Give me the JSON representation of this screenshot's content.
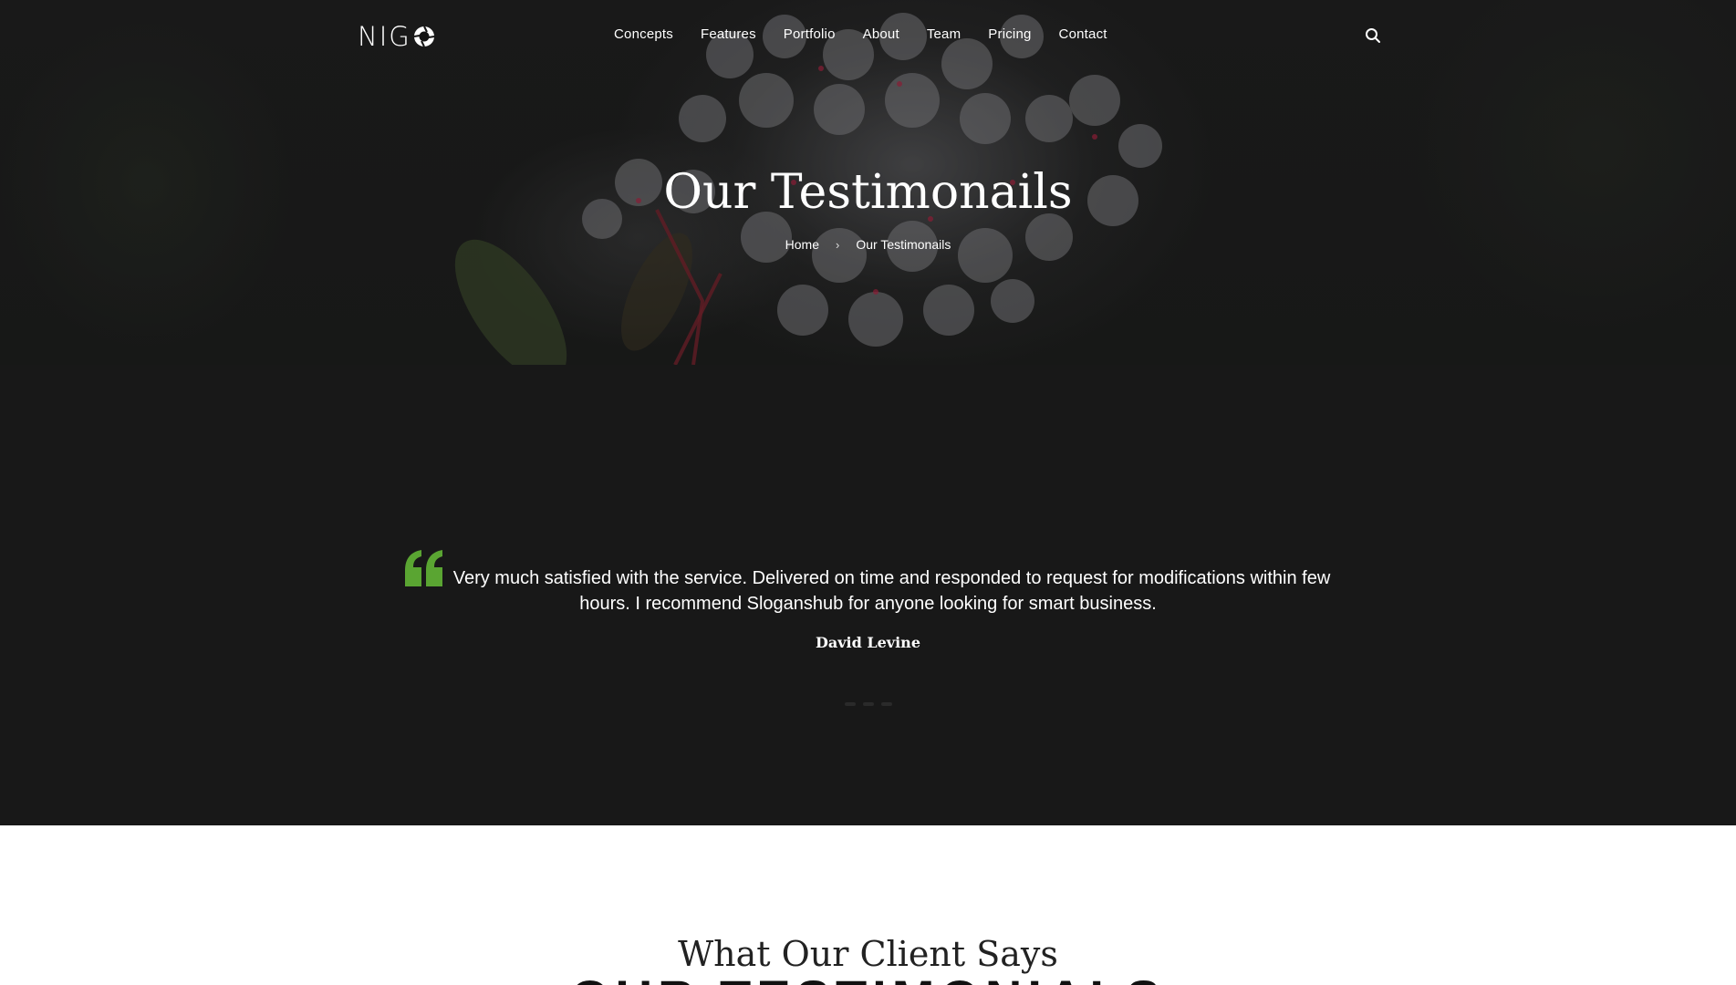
{
  "brand": {
    "name": "NIG",
    "logo_icon": "aperture-icon"
  },
  "nav": {
    "items": [
      "Concepts",
      "Features",
      "Portfolio",
      "About",
      "Team",
      "Pricing",
      "Contact"
    ],
    "search_icon": "search-icon"
  },
  "hero": {
    "title": "Our Testimonails",
    "breadcrumb": {
      "home": "Home",
      "separator": "›",
      "current": "Our Testimonails"
    }
  },
  "testimonial": {
    "quote_icon_color": "#5aa532",
    "text": "Very much satisfied with the service. Delivered on time and responded to request for modifications within few hours. I recommend Sloganshub for anyone looking for smart business.",
    "author": "David Levine",
    "slide_count": 3
  },
  "client_section": {
    "subtitle": "What Our Client Says",
    "title": "OUR TESTIMONIALS"
  }
}
